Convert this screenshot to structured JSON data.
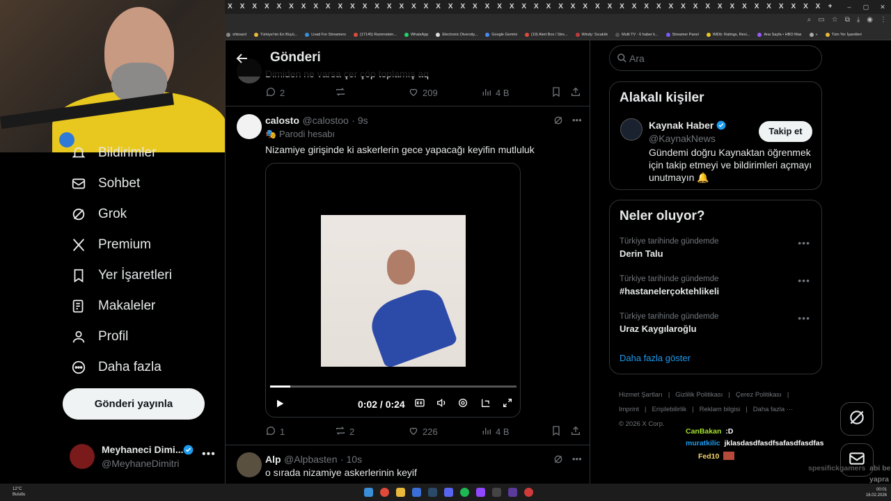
{
  "browser": {
    "tab_glyph": "X",
    "tab_count": 49,
    "new_tab": "+",
    "window_controls": [
      "–",
      "▢",
      "✕"
    ],
    "bookmarks": [
      "shboard",
      "Türkiye'nin En Büyü...",
      "Livad For Streamers",
      "(17145) Rammstein...",
      "WhatsApp",
      "Electronic Diversity...",
      "Google Gemini",
      "(19) Alert Box / Stre...",
      "Windy: Sıcaklık",
      "Multi TV - 6 haber k...",
      "Streamer Panel",
      "IMDb: Ratings, Revi...",
      "Ana Sayfa • HBO Max",
      "»",
      "Tüm Yer İşaretleri"
    ]
  },
  "nav": {
    "items": [
      {
        "label": "Bildirimler",
        "icon": "bell-icon"
      },
      {
        "label": "Sohbet",
        "icon": "envelope-icon"
      },
      {
        "label": "Grok",
        "icon": "grok-icon"
      },
      {
        "label": "Premium",
        "icon": "x-logo-icon"
      },
      {
        "label": "Yer İşaretleri",
        "icon": "bookmark-icon"
      },
      {
        "label": "Makaleler",
        "icon": "article-icon"
      },
      {
        "label": "Profil",
        "icon": "person-icon"
      },
      {
        "label": "Daha fazla",
        "icon": "more-circle-icon"
      }
    ],
    "post_button": "Gönderi yayınla",
    "account": {
      "name": "Meyhaneci Dimi...",
      "handle": "@MeyhaneDimitri",
      "more": "•••"
    }
  },
  "center": {
    "header_title": "Gönderi",
    "prev_post": {
      "text": "Dimiden ne varsa çer çöp toplamış aq",
      "replies": "2",
      "reposts": "",
      "likes": "209",
      "views": "4 B"
    },
    "tweet": {
      "name": "calosto",
      "handle": "@calostoo",
      "time": "· 9s",
      "label": "Parodi hesabı",
      "text": "Nizamiye girişinde ki askerlerin gece yapacağı keyifin mutluluk",
      "video": {
        "time": "0:02 / 0:24",
        "progress": 0.083
      },
      "replies": "1",
      "reposts": "2",
      "likes": "226",
      "views": "4 B"
    },
    "reply": {
      "name": "Alp",
      "handle": "@Alpbasten",
      "time": "· 10s",
      "text": "o sırada nizamiye askerlerinin keyif"
    }
  },
  "right": {
    "search_placeholder": "Ara",
    "related": {
      "title": "Alakalı kişiler",
      "name": "Kaynak Haber",
      "handle": "@KaynakNews",
      "follow": "Takip et",
      "bio": "Gündemi doğru Kaynaktan öğrenmek için takip etmeyi ve bildirimleri açmayı unutmayın 🔔"
    },
    "trends": {
      "title": "Neler oluyor?",
      "items": [
        {
          "meta": "Türkiye tarihinde gündemde",
          "name": "Derin Talu"
        },
        {
          "meta": "Türkiye tarihinde gündemde",
          "name": "#hastanelerçoktehlikeli"
        },
        {
          "meta": "Türkiye tarihinde gündemde",
          "name": "Uraz Kaygılaroğlu"
        }
      ],
      "show_more": "Daha fazla göster",
      "more_glyph": "•••"
    },
    "footer": [
      "Hizmet Şartları",
      "|",
      "Gizlilik Politikası",
      "|",
      "Çerez Politikası",
      "|",
      "Imprint",
      "|",
      "Erişilebilirlik",
      "|",
      "Reklam bilgisi",
      "|",
      "Daha fazla ···",
      "© 2026 X Corp."
    ]
  },
  "chat": [
    {
      "user": "CanBakan",
      "msg": ":D",
      "color": "#a6e22e"
    },
    {
      "user": "muratkilic",
      "msg": "jklasdasdfasdfsafasdfasdfas",
      "color": "#1d9bf0"
    },
    {
      "user": "Fed10",
      "msg": "",
      "color": "#f5d76e"
    },
    {
      "user": "spesifickgamers",
      "msg": "abi be",
      "color": "#555555"
    },
    {
      "user": "",
      "msg": "yapra",
      "color": "#777777"
    }
  ],
  "taskbar": {
    "weather_temp": "12°C",
    "weather_text": "Bulutlu",
    "time": "00:01",
    "date": "16.02.2026"
  },
  "colors": {
    "accent": "#1d9bf0",
    "bg": "#000000",
    "border": "#2f3336",
    "muted": "#71767b"
  }
}
